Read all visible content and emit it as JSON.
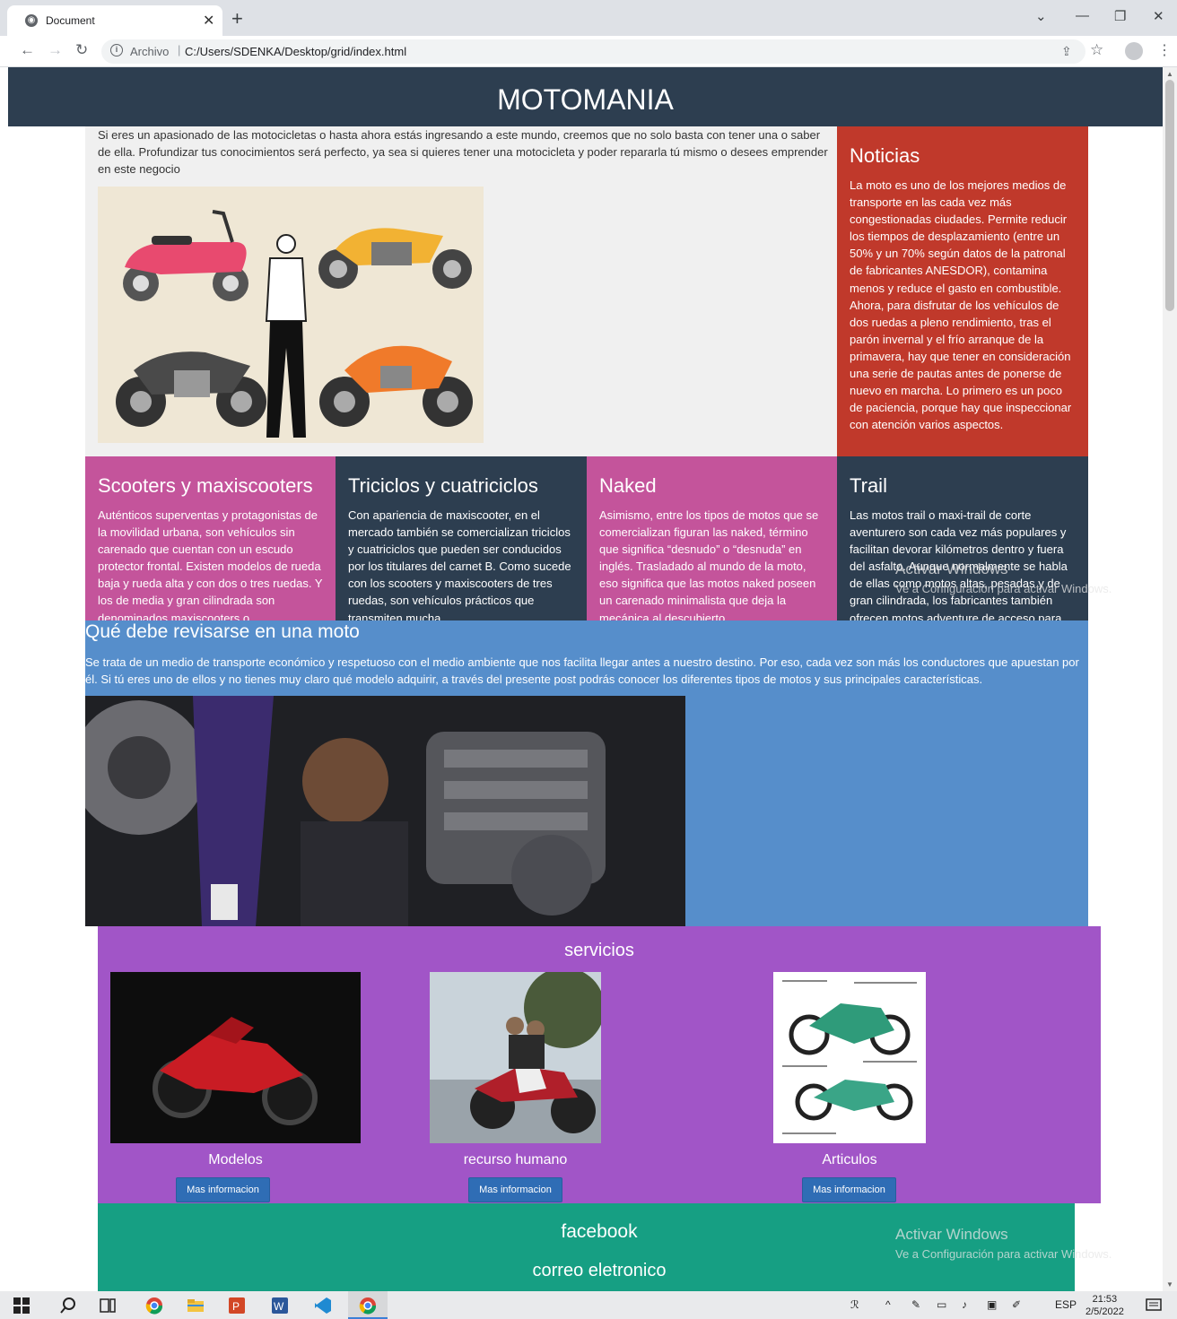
{
  "browser": {
    "tab_title": "Document",
    "address_prefix": "Archivo",
    "address_separator": "|",
    "url": "C:/Users/SDENKA/Desktop/grid/index.html"
  },
  "page": {
    "header_title": "MOTOMANIA",
    "intro_text": "Si eres un apasionado de las motocicletas o hasta ahora estás ingresando a este mundo, creemos que no solo basta con tener una o saber de ella. Profundizar tus conocimientos será perfecto, ya sea si quieres tener una motocicleta y poder repararla tú mismo o desees emprender en este negocio",
    "noticias": {
      "title": "Noticias",
      "text": "La moto es uno de los mejores medios de transporte en las cada vez más congestionadas ciudades. Permite reducir los tiempos de desplazamiento (entre un 50% y un 70% según datos de la patronal de fabricantes ANESDOR), contamina menos y reduce el gasto en combustible. Ahora, para disfrutar de los vehículos de dos ruedas a pleno rendimiento, tras el parón invernal y el frío arranque de la primavera, hay que tener en consideración una serie de pautas antes de ponerse de nuevo en marcha. Lo primero es un poco de paciencia, porque hay que inspeccionar con atención varios aspectos."
    },
    "cards": [
      {
        "title": "Scooters y maxiscooters",
        "text": "Auténticos superventas y protagonistas de la movilidad urbana, son vehículos sin carenado que cuentan con un escudo protector frontal. Existen modelos de rueda baja y rueda alta y con dos o tres ruedas. Y los de media y gran cilindrada son denominados maxiscooters o",
        "color": "#c4549b"
      },
      {
        "title": "Triciclos y cuatriciclos",
        "text": "Con apariencia de maxiscooter, en el mercado también se comercializan triciclos y cuatriciclos que pueden ser conducidos por los titulares del carnet B. Como sucede con los scooters y maxiscooters de tres ruedas, son vehículos prácticos que transmiten mucha",
        "color": "#2d3e50"
      },
      {
        "title": "Naked",
        "text": "Asimismo, entre los tipos de motos que se comercializan figuran las naked, término que significa “desnudo” o “desnuda” en inglés. Trasladado al mundo de la moto, eso significa que las motos naked poseen un carenado minimalista que deja la mecánica al descubierto",
        "color": "#c4549b"
      },
      {
        "title": "Trail",
        "text": "Las motos trail o maxi-trail de corte aventurero son cada vez más populares y facilitan devorar kilómetros dentro y fuera del asfalto. Aunque normalmente se habla de ellas como motos altas, pesadas y de gran cilindrada, los fabricantes también ofrecen motos adventure de acceso para",
        "color": "#2d3e50"
      }
    ],
    "revisar": {
      "title": "Qué debe revisarse en una moto",
      "text": "Se trata de un medio de transporte económico y respetuoso con el medio ambiente que nos facilita llegar antes a nuestro destino. Por eso, cada vez son más los conductores que apuestan por él. Si tú eres uno de ellos y no tienes muy claro qué modelo adquirir, a través del presente post podrás conocer los diferentes tipos de motos y sus principales características."
    },
    "servicios": {
      "title": "servicios",
      "items": [
        {
          "label": "Modelos",
          "button": "Mas informacion"
        },
        {
          "label": "recurso humano",
          "button": "Mas informacion"
        },
        {
          "label": "Articulos",
          "button": "Mas informacion"
        }
      ]
    },
    "footer": {
      "facebook": "facebook",
      "correo": "correo eletronico"
    },
    "watermark": {
      "title": "Activar Windows",
      "subtitle": "Ve a Configuración para activar Windows."
    }
  },
  "taskbar": {
    "language": "ESP",
    "time": "21:53",
    "date": "2/5/2022"
  },
  "colors": {
    "header": "#2d3e50",
    "noticias": "#c0392b",
    "revisar": "#568ecb",
    "servicios": "#a155c7",
    "footer": "#169f83",
    "button": "#2f6db5"
  }
}
